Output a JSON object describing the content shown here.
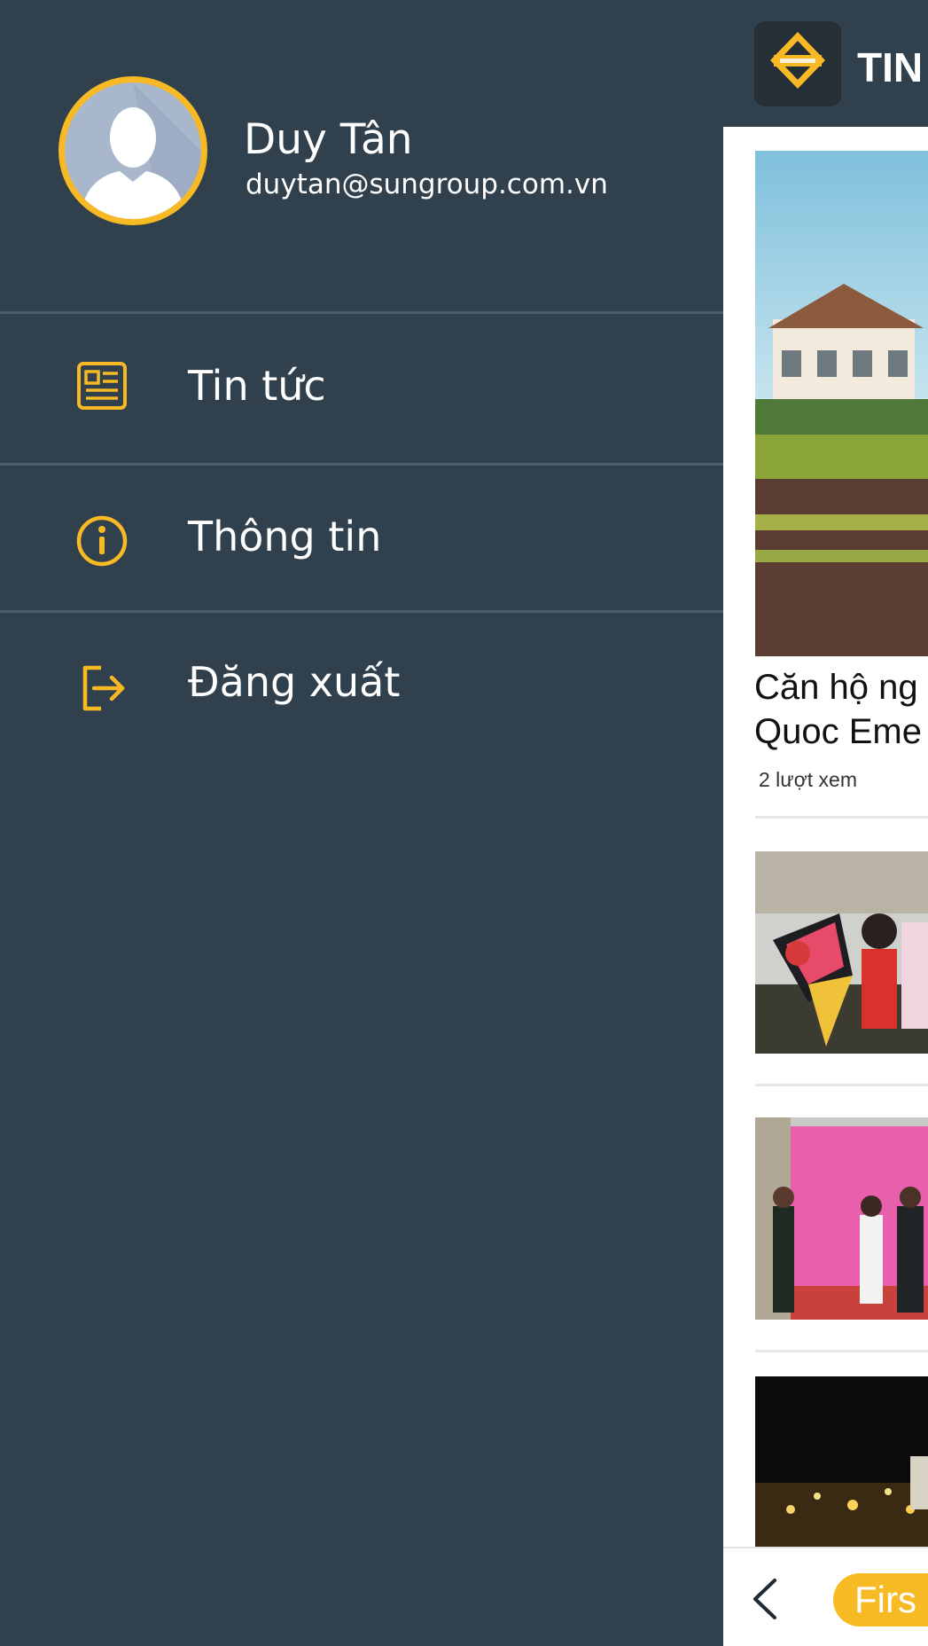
{
  "profile": {
    "name": "Duy Tân",
    "email": "duytan@sungroup.com.vn"
  },
  "menu": [
    {
      "label": "Tin tức",
      "icon": "newspaper-icon"
    },
    {
      "label": "Thông tin",
      "icon": "info-icon"
    },
    {
      "label": "Đăng xuất",
      "icon": "logout-icon"
    }
  ],
  "app": {
    "header_title": "TIN",
    "news": [
      {
        "title_line1": "Căn hộ ng",
        "title_line2": "Quoc Eme",
        "views": "2 lượt xem"
      }
    ],
    "pagination": {
      "first_label": "Firs"
    }
  },
  "colors": {
    "drawer_bg": "#30414d",
    "accent": "#f7b924",
    "divider": "#4d5d69"
  }
}
